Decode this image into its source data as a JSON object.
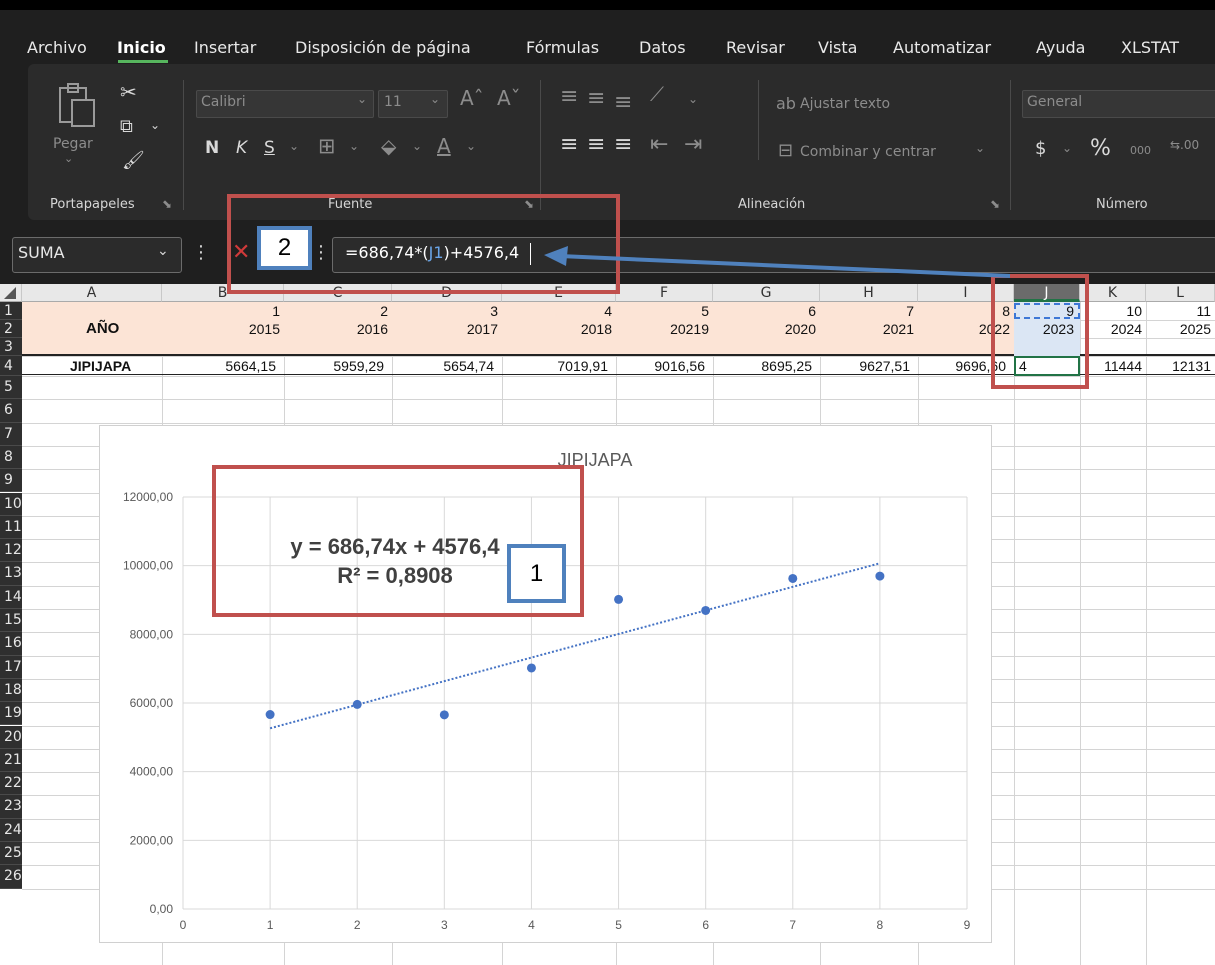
{
  "menu": [
    "Archivo",
    "Inicio",
    "Insertar",
    "Disposición de página",
    "Fórmulas",
    "Datos",
    "Revisar",
    "Vista",
    "Automatizar",
    "Ayuda",
    "XLSTAT"
  ],
  "ribbon": {
    "paste_label": "Pegar",
    "font_name": "Calibri",
    "font_size": "11",
    "bold": "N",
    "italic": "K",
    "underline": "S",
    "wrap_text": "Ajustar texto",
    "merge_center": "Combinar y centrar",
    "number_format": "General",
    "groups": [
      "Portapapeles",
      "Fuente",
      "Alineación",
      "Número"
    ]
  },
  "formula_bar": {
    "name_box": "SUMA",
    "formula_prefix": "=686,74*(",
    "formula_ref": "J1",
    "formula_suffix": ")+4576,4"
  },
  "columns": [
    "A",
    "B",
    "C",
    "D",
    "E",
    "F",
    "G",
    "H",
    "I",
    "J",
    "K",
    "L"
  ],
  "rows": [
    "1",
    "2",
    "3",
    "4",
    "5",
    "6",
    "7",
    "8",
    "9",
    "10",
    "11",
    "12",
    "13",
    "14",
    "15",
    "16",
    "17",
    "18",
    "19",
    "20",
    "21",
    "22",
    "23",
    "24",
    "25",
    "26"
  ],
  "sheet": {
    "label_year": "AÑO",
    "label_city": "JIPIJAPA",
    "row1": [
      "1",
      "2",
      "3",
      "4",
      "5",
      "6",
      "7",
      "8",
      "9",
      "10",
      "11"
    ],
    "row2": [
      "2015",
      "2016",
      "2017",
      "2018",
      "20219",
      "2020",
      "2021",
      "2022",
      "2023",
      "2024",
      "2025"
    ],
    "row3": [
      "5664,15",
      "5959,29",
      "5654,74",
      "7019,91",
      "9016,56",
      "8695,25",
      "9627,51",
      "9696,60",
      "4",
      "11444",
      "12131"
    ]
  },
  "annotations": {
    "box1": "1",
    "box2": "2"
  },
  "chart_data": {
    "type": "scatter",
    "title": "JIPIJAPA",
    "x": [
      1,
      2,
      3,
      4,
      5,
      6,
      7,
      8
    ],
    "y": [
      5664.15,
      5959.29,
      5654.74,
      7019.91,
      9016.56,
      8695.25,
      9627.51,
      9696.6
    ],
    "xlim": [
      0,
      9
    ],
    "ylim": [
      0,
      12000
    ],
    "xticks": [
      "0",
      "1",
      "2",
      "3",
      "4",
      "5",
      "6",
      "7",
      "8",
      "9"
    ],
    "yticks": [
      "0,00",
      "2000,00",
      "4000,00",
      "6000,00",
      "8000,00",
      "10000,00",
      "12000,00"
    ],
    "trendline": {
      "type": "linear",
      "slope": 686.74,
      "intercept": 4576.4,
      "from": 1,
      "to": 8
    },
    "equation": "y = 686,74x + 4576,4",
    "r2": "R² = 0,8908",
    "grid": true,
    "colors": {
      "marker": "#4472c4",
      "trend": "#4472c4"
    }
  }
}
